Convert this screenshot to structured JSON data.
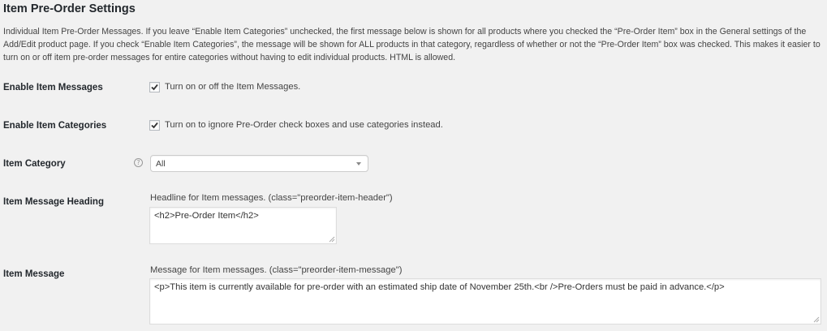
{
  "section": {
    "title": "Item Pre-Order Settings",
    "description": "Individual Item Pre-Order Messages. If you leave “Enable Item Categories” unchecked, the first message below is shown for all products where you checked the “Pre-Order Item” box in the General settings of the Add/Edit product page. If you check “Enable Item Categories”, the message will be shown for ALL products in that category, regardless of whether or not the “Pre-Order Item” box was checked. This makes it easier to turn on or off item pre-order messages for entire categories without having to edit individual products. HTML is allowed."
  },
  "fields": {
    "enable_item_messages": {
      "label": "Enable Item Messages",
      "checked": true,
      "checkbox_label": "Turn on or off the Item Messages."
    },
    "enable_item_categories": {
      "label": "Enable Item Categories",
      "checked": true,
      "checkbox_label": "Turn on to ignore Pre-Order check boxes and use categories instead."
    },
    "item_category": {
      "label": "Item Category",
      "help_icon": "question-circle-icon",
      "help_glyph": "?",
      "selected": "All"
    },
    "item_message_heading": {
      "label": "Item Message Heading",
      "description": "Headline for Item messages. (class=\"preorder-item-header\")",
      "value": "<h2>Pre-Order Item</h2>"
    },
    "item_message": {
      "label": "Item Message",
      "description": "Message for Item messages. (class=\"preorder-item-message\")",
      "value": "<p>This item is currently available for pre-order with an estimated ship date of November 25th.<br />Pre-Orders must be paid in advance.</p>"
    }
  },
  "colors": {
    "background": "#f1f1f1",
    "checkmark": "#1e8cbe",
    "text": "#23282d"
  }
}
